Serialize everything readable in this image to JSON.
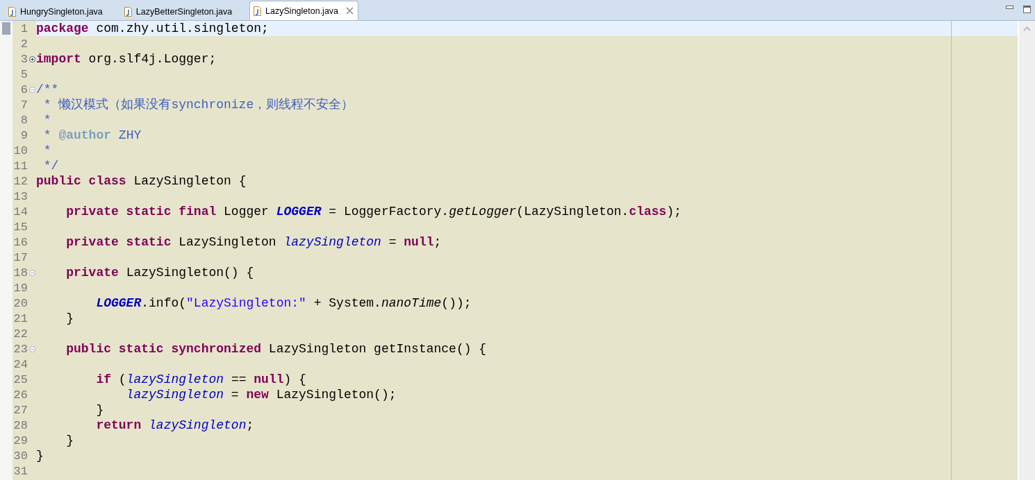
{
  "tabs": [
    {
      "label": "HungrySingleton.java",
      "selected": false
    },
    {
      "label": "LazyBetterSingleton.java",
      "selected": false
    },
    {
      "label": "LazySingleton.java",
      "selected": true
    }
  ],
  "editor": {
    "lines": [
      {
        "number": "1",
        "current": true,
        "tokens": [
          {
            "kind": "keyword",
            "text": "package"
          },
          {
            "kind": "plain",
            "text": " com.zhy.util.singleton;"
          }
        ]
      },
      {
        "number": "2",
        "current": false
      },
      {
        "number": "3",
        "current": false,
        "folded": true,
        "tokens": [
          {
            "kind": "keyword",
            "text": "import"
          },
          {
            "kind": "plain",
            "text": " org.slf4j.Logger;"
          }
        ]
      },
      {
        "number": "5",
        "current": false
      },
      {
        "number": "6",
        "current": false,
        "folded": false,
        "tokens": [
          {
            "kind": "doc",
            "text": "/**"
          }
        ]
      },
      {
        "number": "7",
        "current": false,
        "tokens": [
          {
            "kind": "doc",
            "text": " * 懒汉模式（如果没有synchronize，则线程不安全）"
          }
        ]
      },
      {
        "number": "8",
        "current": false,
        "tokens": [
          {
            "kind": "doc",
            "text": " *"
          }
        ]
      },
      {
        "number": "9",
        "current": false,
        "tokens": [
          {
            "kind": "doc",
            "text": " * "
          },
          {
            "kind": "doctag",
            "text": "@author"
          },
          {
            "kind": "doc",
            "text": " ZHY"
          }
        ]
      },
      {
        "number": "10",
        "current": false,
        "tokens": [
          {
            "kind": "doc",
            "text": " *"
          }
        ]
      },
      {
        "number": "11",
        "current": false,
        "tokens": [
          {
            "kind": "doc",
            "text": " */"
          }
        ]
      },
      {
        "number": "12",
        "current": false,
        "tokens": [
          {
            "kind": "keyword",
            "text": "public class"
          },
          {
            "kind": "plain",
            "text": " LazySingleton {"
          }
        ]
      },
      {
        "number": "13",
        "current": false
      },
      {
        "number": "14",
        "current": false,
        "tokens": [
          {
            "kind": "keyword",
            "text": "    private static final"
          },
          {
            "kind": "plain",
            "text": " Logger "
          },
          {
            "kind": "constant",
            "text": "LOGGER"
          },
          {
            "kind": "plain",
            "text": " = LoggerFactory."
          },
          {
            "kind": "static-method",
            "text": "getLogger"
          },
          {
            "kind": "plain",
            "text": "(LazySingleton."
          },
          {
            "kind": "keyword",
            "text": "class"
          },
          {
            "kind": "plain",
            "text": ");"
          }
        ]
      },
      {
        "number": "15",
        "current": false
      },
      {
        "number": "16",
        "current": false,
        "tokens": [
          {
            "kind": "keyword",
            "text": "    private static"
          },
          {
            "kind": "plain",
            "text": " LazySingleton "
          },
          {
            "kind": "field",
            "text": "lazySingleton"
          },
          {
            "kind": "plain",
            "text": " = "
          },
          {
            "kind": "keyword",
            "text": "null"
          },
          {
            "kind": "plain",
            "text": ";"
          }
        ]
      },
      {
        "number": "17",
        "current": false
      },
      {
        "number": "18",
        "current": false,
        "folded": false,
        "tokens": [
          {
            "kind": "keyword",
            "text": "    private"
          },
          {
            "kind": "plain",
            "text": " LazySingleton() {"
          }
        ]
      },
      {
        "number": "19",
        "current": false
      },
      {
        "number": "20",
        "current": false,
        "tokens": [
          {
            "kind": "constant",
            "text": "        LOGGER"
          },
          {
            "kind": "plain",
            "text": ".info("
          },
          {
            "kind": "string",
            "text": "\"LazySingleton:\""
          },
          {
            "kind": "plain",
            "text": " + System."
          },
          {
            "kind": "static-method",
            "text": "nanoTime"
          },
          {
            "kind": "plain",
            "text": "());"
          }
        ]
      },
      {
        "number": "21",
        "current": false,
        "tokens": [
          {
            "kind": "plain",
            "text": "    }"
          }
        ]
      },
      {
        "number": "22",
        "current": false
      },
      {
        "number": "23",
        "current": false,
        "folded": false,
        "tokens": [
          {
            "kind": "keyword",
            "text": "    public static synchronized"
          },
          {
            "kind": "plain",
            "text": " LazySingleton getInstance() {"
          }
        ]
      },
      {
        "number": "24",
        "current": false
      },
      {
        "number": "25",
        "current": false,
        "tokens": [
          {
            "kind": "keyword",
            "text": "        if"
          },
          {
            "kind": "plain",
            "text": " ("
          },
          {
            "kind": "field",
            "text": "lazySingleton"
          },
          {
            "kind": "plain",
            "text": " == "
          },
          {
            "kind": "keyword",
            "text": "null"
          },
          {
            "kind": "plain",
            "text": ") {"
          }
        ]
      },
      {
        "number": "26",
        "current": false,
        "tokens": [
          {
            "kind": "field",
            "text": "            lazySingleton"
          },
          {
            "kind": "plain",
            "text": " = "
          },
          {
            "kind": "keyword",
            "text": "new"
          },
          {
            "kind": "plain",
            "text": " LazySingleton();"
          }
        ]
      },
      {
        "number": "27",
        "current": false,
        "tokens": [
          {
            "kind": "plain",
            "text": "        }"
          }
        ]
      },
      {
        "number": "28",
        "current": false,
        "tokens": [
          {
            "kind": "keyword",
            "text": "        return"
          },
          {
            "kind": "field",
            "text": " lazySingleton"
          },
          {
            "kind": "plain",
            "text": ";"
          }
        ]
      },
      {
        "number": "29",
        "current": false,
        "tokens": [
          {
            "kind": "plain",
            "text": "    }"
          }
        ]
      },
      {
        "number": "30",
        "current": false,
        "tokens": [
          {
            "kind": "plain",
            "text": "}"
          }
        ]
      },
      {
        "number": "31",
        "current": false
      }
    ]
  }
}
